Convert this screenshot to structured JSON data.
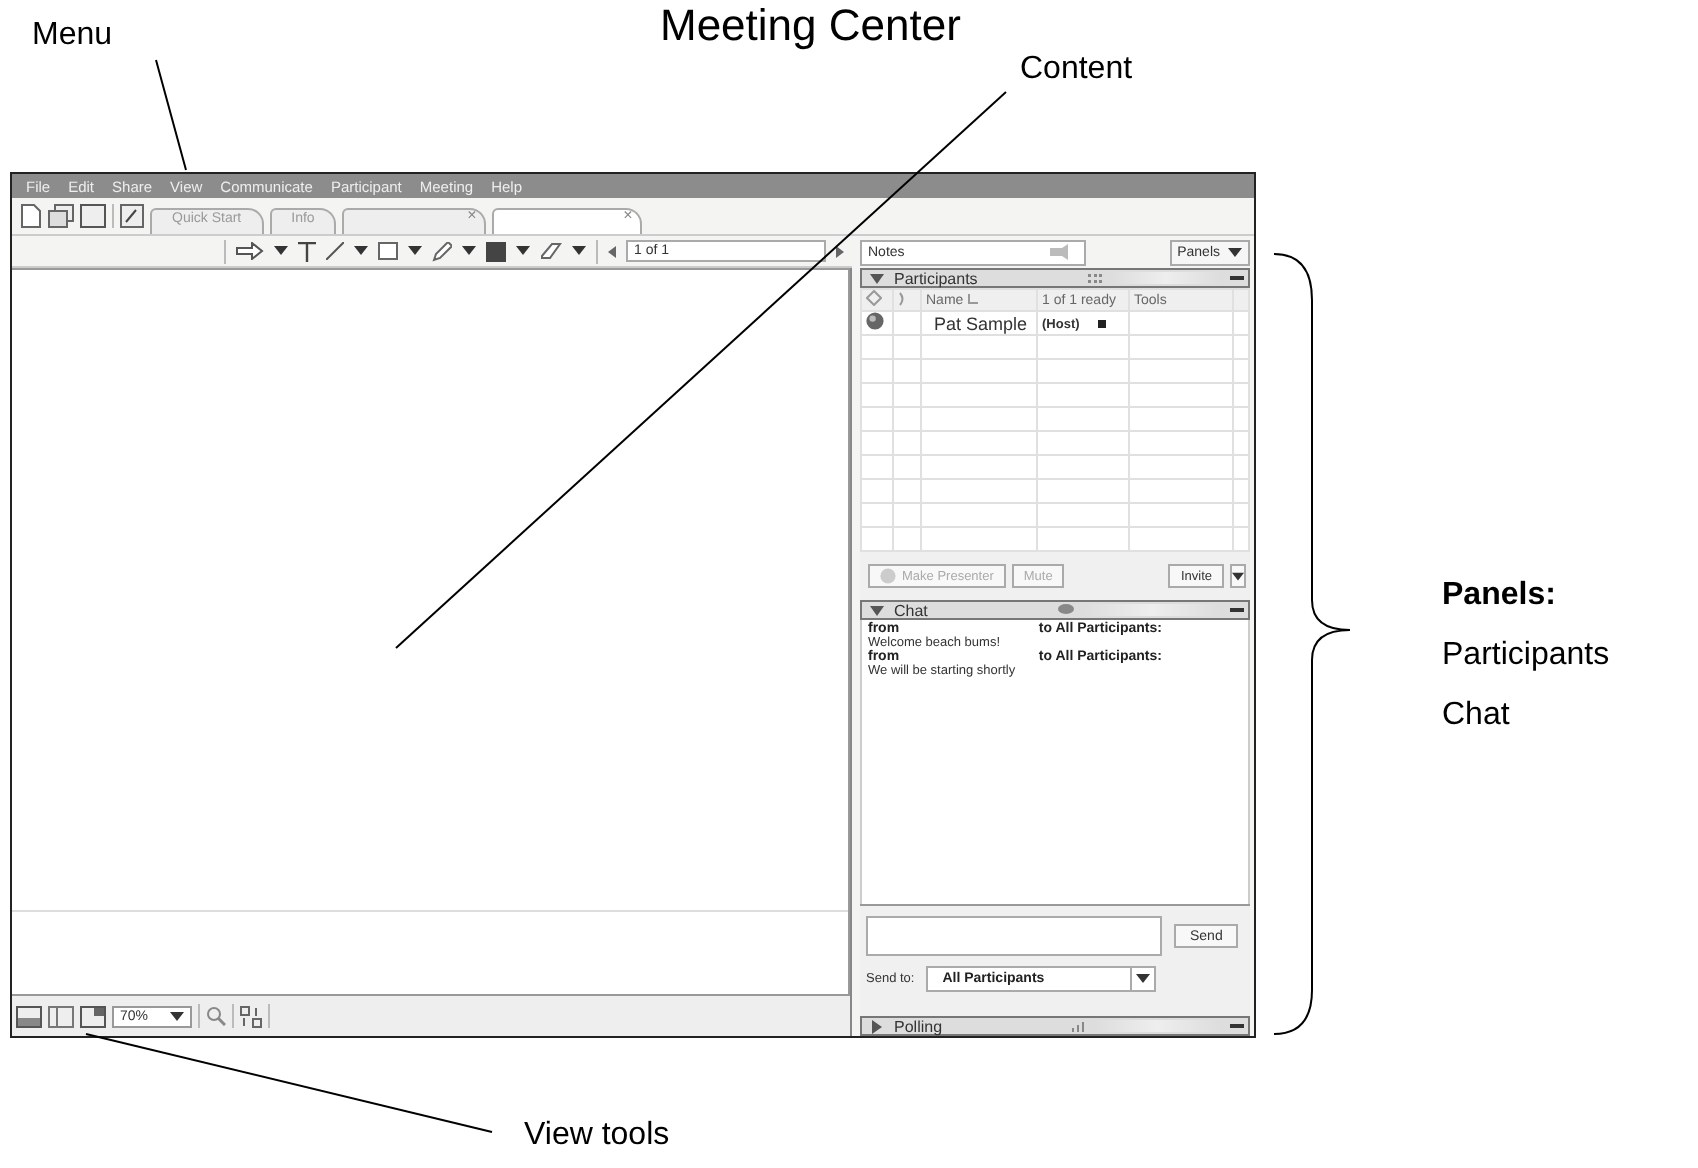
{
  "figure_title": "Meeting Center",
  "callouts": {
    "menu": "Menu",
    "content": "Content",
    "view_tools": "View tools",
    "panels_heading": "Panels:",
    "panels_list": [
      "Participants",
      "Chat"
    ]
  },
  "menu": [
    "File",
    "Edit",
    "Share",
    "View",
    "Communicate",
    "Participant",
    "Meeting",
    "Help"
  ],
  "tabs": [
    {
      "label": "Quick Start",
      "selected": false
    },
    {
      "label": "Info",
      "selected": false
    },
    {
      "close": "×",
      "selected": false
    },
    {
      "close": "×",
      "selected": true
    }
  ],
  "page_field": "1 of 1",
  "notes": "Notes",
  "panels_button": "Panels",
  "participants": {
    "title": "Participants",
    "expanded": true,
    "columns": [
      "Name",
      "1 of 1 ready",
      "Tools"
    ],
    "rows": [
      {
        "name": "Pat Sample",
        "role": "(Host)"
      }
    ],
    "buttons": [
      {
        "label": "Make Presenter",
        "disabled": true
      },
      {
        "label": "Mute",
        "disabled": true
      },
      {
        "label": "Invite",
        "disabled": false
      }
    ]
  },
  "chat": {
    "title": "Chat",
    "expanded": true,
    "messages": [
      {
        "from": "from",
        "to": "to All Participants:",
        "text": "Welcome beach bums!"
      },
      {
        "from": "from",
        "to": "to All Participants:",
        "text": "We will be starting shortly"
      }
    ],
    "send": "Send",
    "send_to_label": "Send to:",
    "send_to": "All Participants"
  },
  "polling": {
    "title": "Polling",
    "expanded": false
  },
  "zoom": "70%"
}
